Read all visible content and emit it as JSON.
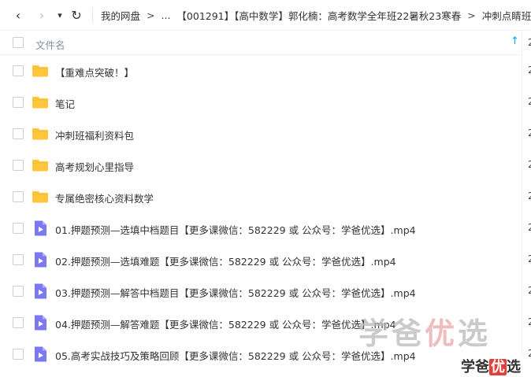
{
  "nav": {
    "back_icon": "chevron-left-icon",
    "forward_icon": "chevron-right-icon",
    "dropdown_icon": "caret-down-icon",
    "refresh_icon": "refresh-icon",
    "back_glyph": "‹",
    "forward_glyph": "›",
    "dropdown_glyph": "▾",
    "refresh_glyph": "↻"
  },
  "breadcrumb": {
    "items": [
      "我的网盘",
      "...",
      "【001291】【高中数学】郭化楠：高考数学全年班22暑秋23寒春",
      "冲刺点睛班"
    ],
    "separator": ">"
  },
  "table": {
    "header": {
      "name_label": "文件名",
      "sort_icon": "sort-ascending-icon",
      "sort_glyph": "↑"
    },
    "rows": [
      {
        "type": "folder",
        "icon": "folder-icon",
        "name": "【重难点突破！】",
        "time_fragment": "2"
      },
      {
        "type": "folder",
        "icon": "folder-icon",
        "name": "笔记",
        "time_fragment": "2"
      },
      {
        "type": "folder",
        "icon": "folder-icon",
        "name": "冲刺班福利资料包",
        "time_fragment": "2"
      },
      {
        "type": "folder",
        "icon": "folder-icon",
        "name": "高考规划心里指导",
        "time_fragment": "2"
      },
      {
        "type": "folder",
        "icon": "folder-icon",
        "name": "专属绝密核心资料数学",
        "time_fragment": "2"
      },
      {
        "type": "video",
        "icon": "video-file-icon",
        "name": "01.押题预测—选填中档题目【更多课微信：582229 或 公众号：学爸优选】.mp4",
        "time_fragment": "2"
      },
      {
        "type": "video",
        "icon": "video-file-icon",
        "name": "02.押题预测—选填难题【更多课微信：582229 或 公众号：学爸优选】.mp4",
        "time_fragment": "2"
      },
      {
        "type": "video",
        "icon": "video-file-icon",
        "name": "03.押题预测—解答中档题目【更多课微信：582229 或 公众号：学爸优选】.mp4",
        "time_fragment": "2"
      },
      {
        "type": "video",
        "icon": "video-file-icon",
        "name": "04.押题预测—解答难题【更多课微信：582229 或 公众号：学爸优选】.mp4",
        "time_fragment": "2"
      },
      {
        "type": "video",
        "icon": "video-file-icon",
        "name": "05.高考实战技巧及策略回顾【更多课微信：582229 或 公众号：学爸优选】.mp4",
        "time_fragment": "2"
      }
    ],
    "header_time_fragment": "2"
  },
  "watermark": {
    "big_part1": "学爸",
    "big_accent": "优",
    "big_part2": "选",
    "small_part1": "学爸",
    "small_accent": "优",
    "small_part2": "选"
  },
  "colors": {
    "accent": "#06a7ff",
    "folder": "#ffc53d",
    "video": "#7b78f2"
  }
}
